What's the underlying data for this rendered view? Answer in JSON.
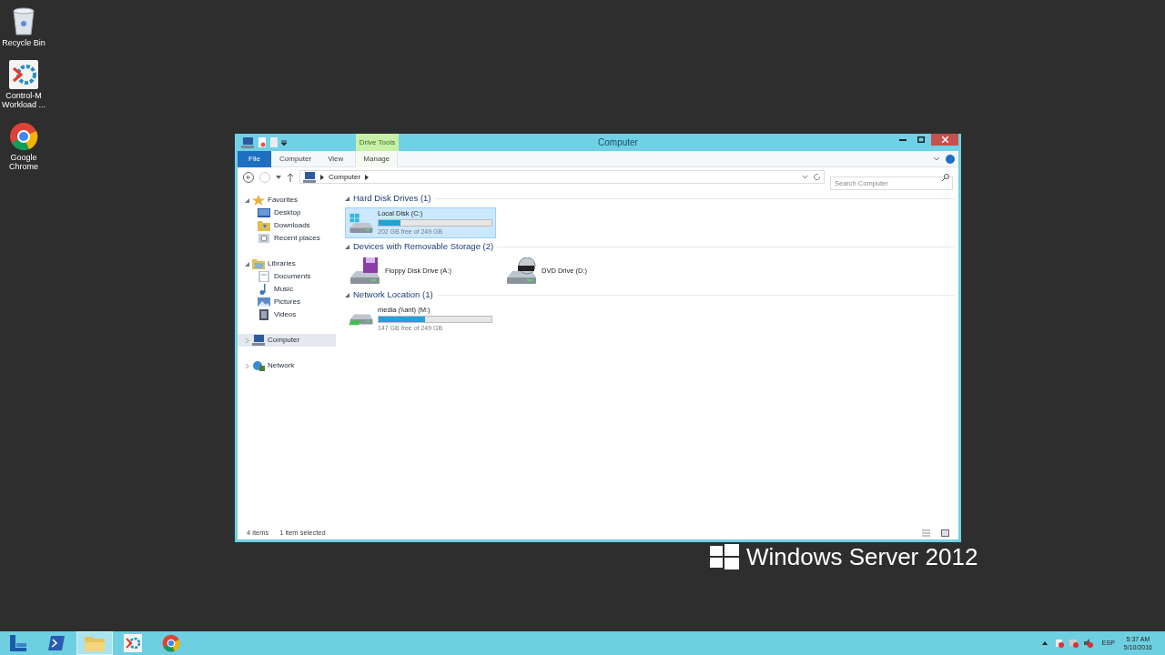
{
  "desktop_icons": [
    {
      "label": "Recycle Bin",
      "kind": "recycle"
    },
    {
      "label": "Control-M Workload ...",
      "kind": "controlm"
    },
    {
      "label": "Google Chrome",
      "kind": "chrome"
    }
  ],
  "branding": "Windows Server 2012",
  "window": {
    "title": "Computer",
    "contextual_group": "Drive Tools",
    "ribbon_tabs": [
      {
        "label": "File",
        "kind": "file",
        "selected": false
      },
      {
        "label": "Computer",
        "kind": "tab",
        "selected": false
      },
      {
        "label": "View",
        "kind": "tab",
        "selected": false
      },
      {
        "label": "Manage",
        "kind": "contextual",
        "selected": false
      }
    ],
    "address": {
      "path": "Computer"
    },
    "search": {
      "placeholder": "Search Computer"
    },
    "nav": [
      {
        "label": "Favorites",
        "kind": "favorites",
        "expanded": true,
        "selected": false,
        "children": [
          {
            "label": "Desktop",
            "kind": "desktop"
          },
          {
            "label": "Downloads",
            "kind": "folder"
          },
          {
            "label": "Recent places",
            "kind": "recent"
          }
        ]
      },
      {
        "label": "Libraries",
        "kind": "libraries",
        "expanded": true,
        "selected": false,
        "children": [
          {
            "label": "Documents",
            "kind": "documents"
          },
          {
            "label": "Music",
            "kind": "music"
          },
          {
            "label": "Pictures",
            "kind": "pictures"
          },
          {
            "label": "Videos",
            "kind": "videos"
          }
        ]
      },
      {
        "label": "Computer",
        "kind": "computer",
        "expanded": false,
        "selected": true
      },
      {
        "label": "Network",
        "kind": "network",
        "expanded": false,
        "selected": false
      }
    ],
    "sections": [
      {
        "title": "Hard Disk Drives (1)",
        "items": [
          {
            "name": "Local Disk (C:)",
            "kind": "hdd",
            "selected": true,
            "level": 0.19,
            "free": "202 GB free of 249 GB"
          }
        ]
      },
      {
        "title": "Devices with Removable Storage (2)",
        "items": [
          {
            "name": "Floppy Disk Drive (A:)",
            "kind": "floppy",
            "selected": false
          },
          {
            "name": "DVD Drive (D:)",
            "kind": "dvd",
            "selected": false
          }
        ]
      },
      {
        "title": "Network Location (1)",
        "items": [
          {
            "name": "media (\\\\ant) (M:)",
            "kind": "network",
            "selected": false,
            "level": 0.41,
            "free": "147 GB free of 249 GB"
          }
        ]
      }
    ],
    "status": {
      "count": "4 items",
      "selection": "1 item selected"
    }
  },
  "taskbar": {
    "apps": [
      {
        "kind": "server-manager",
        "active": false
      },
      {
        "kind": "powershell",
        "active": false
      },
      {
        "kind": "explorer",
        "active": true
      },
      {
        "kind": "controlm",
        "active": false
      },
      {
        "kind": "chrome",
        "active": false
      }
    ],
    "language": "ESP",
    "time": "5:37 AM",
    "date": "5/10/2016"
  }
}
